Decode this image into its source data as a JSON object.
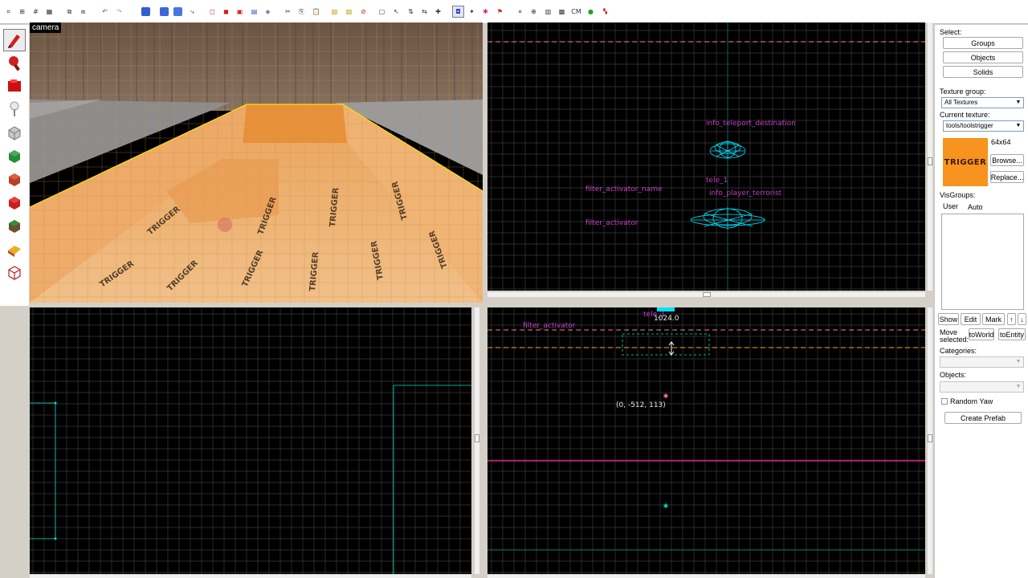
{
  "viewports": {
    "camera_label": "camera",
    "top_labels": {
      "teleport_destination": "info_teleport_destination",
      "tele": "tele_1",
      "player_terrorist": "info_player_terrorist",
      "filter_activator_name": "filter_activator_name",
      "filter_activator": "filter_activator"
    },
    "side_labels": {
      "filter_activator": "filter_activator",
      "tele": "tele_1",
      "dimension": "1024.0",
      "coords": "(0, -512, 113)"
    },
    "camera_texture_text": "TRIGGER"
  },
  "panel": {
    "select_label": "Select:",
    "groups": "Groups",
    "objects": "Objects",
    "solids": "Solids",
    "texture_group_label": "Texture group:",
    "texture_group_value": "All Textures",
    "current_texture_label": "Current texture:",
    "current_texture_value": "tools/toolstrigger",
    "texture_size": "64x64",
    "texture_preview_text": "TRIGGER",
    "browse": "Browse...",
    "replace": "Replace...",
    "visgroups_label": "VisGroups:",
    "tab_user": "User",
    "tab_auto": "Auto",
    "show": "Show",
    "edit": "Edit",
    "mark": "Mark",
    "up_arrow": "↑",
    "down_arrow": "↓",
    "move_selected_1": "Move",
    "move_selected_2": "selected:",
    "to_world": "toWorld",
    "to_entity": "toEntity",
    "categories_label": "Categories:",
    "objects_label": "Objects:",
    "random_yaw": "Random Yaw",
    "create_prefab": "Create Prefab"
  },
  "colors": {
    "grid": "#3a3a3a",
    "entity_label": "#c040c0",
    "entity_mesh": "#00e0ff",
    "trigger_orange": "#f7931e"
  },
  "icons": {
    "tools": [
      "selection-tool-icon",
      "magnify-tool-icon",
      "camera-tool-icon",
      "entity-tool-icon",
      "block-tool-icon",
      "texture-tool-icon",
      "apply-texture-icon",
      "decal-tool-icon",
      "overlay-tool-icon",
      "clip-tool-icon",
      "vertex-tool-icon"
    ]
  }
}
